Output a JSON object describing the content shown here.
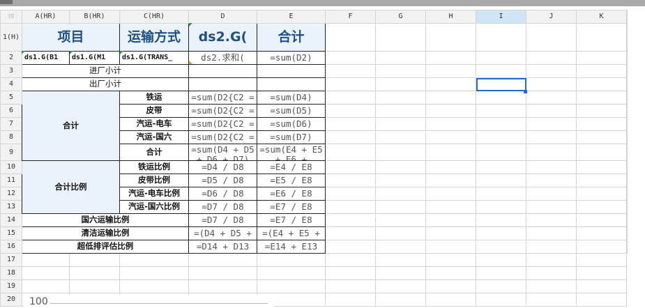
{
  "columns": [
    "A(HR)",
    "B(HR)",
    "C(HR)",
    "D",
    "E",
    "F",
    "G",
    "H",
    "I",
    "J",
    "K"
  ],
  "rows": [
    "1(H)",
    "2",
    "3",
    "4",
    "5",
    "6",
    "7",
    "8",
    "9",
    "10",
    "11",
    "12",
    "13",
    "14",
    "15",
    "16",
    "17",
    "18",
    "19",
    "20"
  ],
  "header": {
    "item": "项目",
    "transport": "运输方式",
    "ds2": "ds2.G(",
    "total": "合计"
  },
  "row2": {
    "a": "ds1.G(B1",
    "b": "ds1.G(M1",
    "c": "ds1.G(TRANS_",
    "d": "ds2.求和(",
    "e": "=sum(D2)"
  },
  "labels": {
    "inbound_subtotal": "进厂小计",
    "outbound_subtotal": "出厂小计",
    "total_group": "合计",
    "ratio_group": "合计比例",
    "guoliu_ratio": "国六运输比例",
    "clean_ratio": "清洁运输比例",
    "ultra_low_ratio": "超低排评估比例"
  },
  "modes": [
    "铁运",
    "皮带",
    "汽运-电车",
    "汽运-国六",
    "合计"
  ],
  "ratio_modes": [
    "铁运比例",
    "皮带比例",
    "汽运-电车比例",
    "汽运-国六比例"
  ],
  "formulas": {
    "d5": "=sum(D2{C2 =",
    "d6": "=sum(D2{C2 =",
    "d7": "=sum(D2{C2 =",
    "d8": "=sum(D2{C2 =",
    "d9": "=sum(D4 + D5 + D6 + D7)",
    "e5": "=sum(D4)",
    "e6": "=sum(D5)",
    "e7": "=sum(D6)",
    "e8": "=sum(D7)",
    "e9": "=sum(E4 + E5 + E6 +",
    "d10": "=D4 / D8",
    "d11": "=D5 / D8",
    "d12": "=D6 / D8",
    "d13": "=D7 / D8",
    "d14": "=D7 / D8",
    "d15": "=(D4 + D5 +",
    "d16": "=D14 + D13",
    "e10": "=E4 / E8",
    "e11": "=E5 / E8",
    "e12": "=E6 / E8",
    "e13": "=E7 / E8",
    "e14": "=E7 / E8",
    "e15": "=(E4 + E5 +",
    "e16": "=E14 + E13"
  },
  "selected_cell": "I4",
  "zoom": "100",
  "colors": {
    "header_bg": "#f2f2f2",
    "label_fill": "#eaf3fb",
    "selection": "#1e6fd0",
    "title_text": "#1f4f86",
    "selected_col_bg": "#cfe6f7"
  }
}
